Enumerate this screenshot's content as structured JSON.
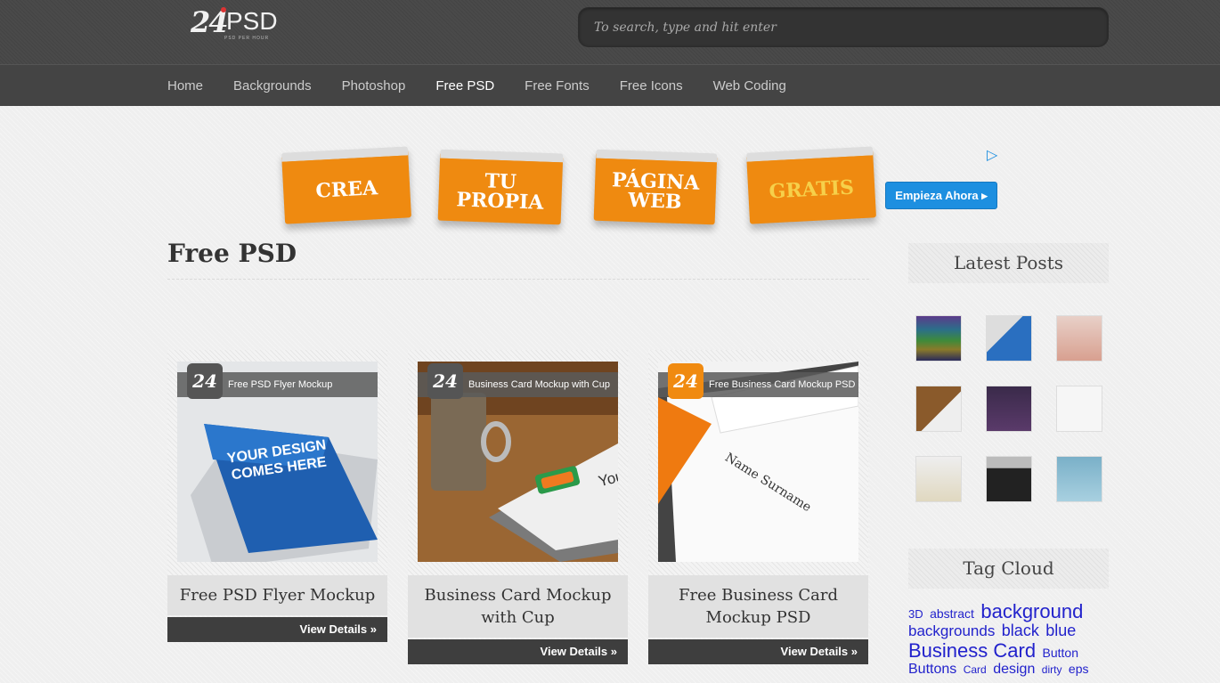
{
  "header": {
    "logo_num": "24",
    "logo_text": "PSD",
    "logo_sub": "PSD PER HOUR",
    "search_placeholder": "To search, type and hit enter"
  },
  "nav": {
    "items": [
      {
        "label": "Home"
      },
      {
        "label": "Backgrounds"
      },
      {
        "label": "Photoshop"
      },
      {
        "label": "Free PSD",
        "active": true
      },
      {
        "label": "Free Fonts"
      },
      {
        "label": "Free Icons"
      },
      {
        "label": "Web Coding"
      }
    ]
  },
  "ad": {
    "cards": [
      "CREA",
      "TU PROPIA",
      "PÁGINA WEB",
      "GRATIS"
    ],
    "cta": "Empieza Ahora ▸",
    "icon": "ad-choices-icon"
  },
  "main": {
    "title": "Free PSD",
    "cards": [
      {
        "title": "Free PSD Flyer Mockup",
        "tag": "Free PSD Flyer Mockup",
        "button": "View Details »",
        "thumb_text": "YOUR DESIGN COMES HERE"
      },
      {
        "title": "Business Card Mockup with Cup",
        "tag": "Business Card Mockup with Cup",
        "button": "View Details »",
        "thumb_text": "You"
      },
      {
        "title": "Free Business Card Mockup PSD",
        "tag": "Free Business Card Mockup PSD",
        "button": "View Details »",
        "thumb_text": "Name Surname"
      }
    ]
  },
  "sidebar": {
    "latest_title": "Latest Posts",
    "tag_title": "Tag Cloud",
    "tags": [
      {
        "label": "3D",
        "size": 13
      },
      {
        "label": "abstract",
        "size": 14
      },
      {
        "label": "background",
        "size": 22
      },
      {
        "label": "backgrounds",
        "size": 17
      },
      {
        "label": "black",
        "size": 18
      },
      {
        "label": "blue",
        "size": 18
      },
      {
        "label": "Business Card",
        "size": 22
      },
      {
        "label": "Button",
        "size": 14
      },
      {
        "label": "Buttons",
        "size": 16
      },
      {
        "label": "Card",
        "size": 12
      },
      {
        "label": "design",
        "size": 16
      },
      {
        "label": "dirty",
        "size": 12
      },
      {
        "label": "eps",
        "size": 14
      }
    ]
  },
  "colors": {
    "header_bg": "#4a4a4a",
    "nav_bg": "#444444",
    "accent_orange": "#ef8a10",
    "cta_blue": "#1d8fe0",
    "tag_link": "#2222cc"
  }
}
